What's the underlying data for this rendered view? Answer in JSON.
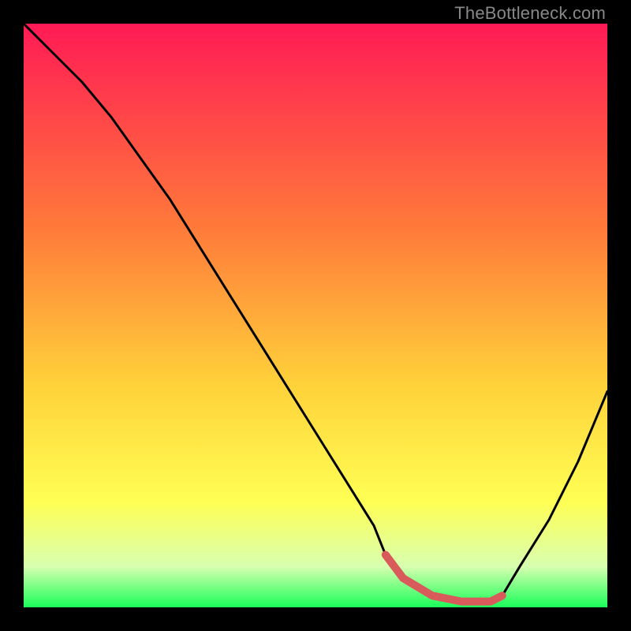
{
  "watermark": "TheBottleneck.com",
  "colors": {
    "top": "#ff1a55",
    "upper_mid": "#ff7a3a",
    "mid": "#ffd23a",
    "lower_mid": "#ffff55",
    "pale_green": "#d8ffb0",
    "green": "#1aff5a",
    "curve": "#000000",
    "highlight": "#d85a5a"
  },
  "chart_data": {
    "type": "line",
    "title": "",
    "xlabel": "",
    "ylabel": "",
    "xlim": [
      0,
      100
    ],
    "ylim": [
      0,
      100
    ],
    "series": [
      {
        "name": "bottleneck-curve",
        "x": [
          0,
          5,
          10,
          15,
          20,
          25,
          30,
          35,
          40,
          45,
          50,
          55,
          60,
          62,
          65,
          70,
          75,
          80,
          82,
          85,
          90,
          95,
          100
        ],
        "y": [
          100,
          95,
          90,
          84,
          77,
          70,
          62,
          54,
          46,
          38,
          30,
          22,
          14,
          9,
          5,
          2,
          1,
          1,
          2,
          7,
          15,
          25,
          37
        ]
      }
    ],
    "highlight_range_x": [
      62,
      82
    ],
    "gradient_stops": [
      {
        "pct": 0,
        "color": "#ff1a55"
      },
      {
        "pct": 35,
        "color": "#ff7a3a"
      },
      {
        "pct": 62,
        "color": "#ffd23a"
      },
      {
        "pct": 82,
        "color": "#ffff55"
      },
      {
        "pct": 93,
        "color": "#d8ffb0"
      },
      {
        "pct": 100,
        "color": "#1aff5a"
      }
    ]
  }
}
